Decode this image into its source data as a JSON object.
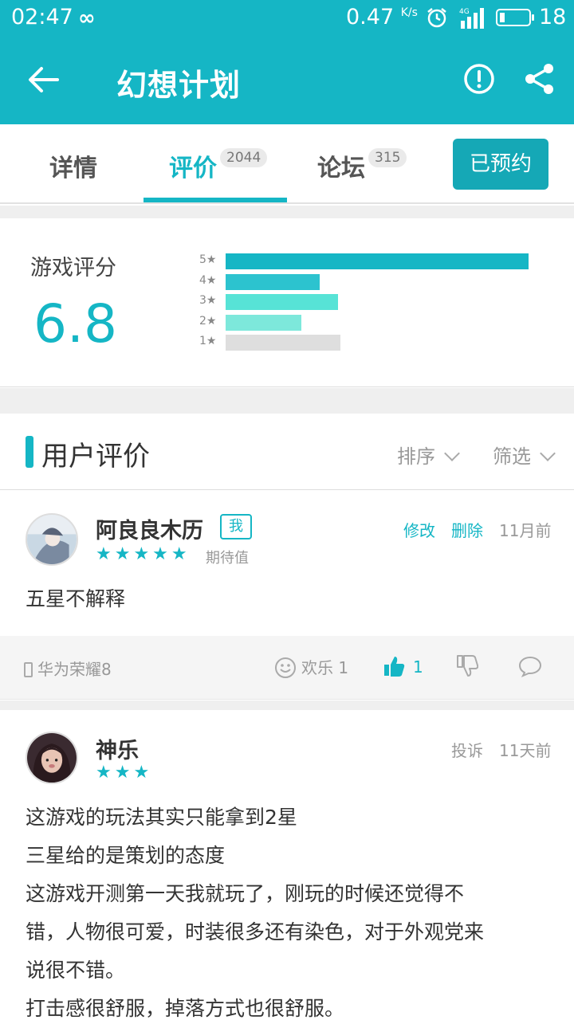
{
  "status_bar": {
    "time": "02:47",
    "infinity": "∞",
    "net_speed": "0.47",
    "net_unit": "K/s",
    "network": "4G",
    "battery": "18"
  },
  "app_bar": {
    "title": "幻想计划",
    "back_icon": "arrow-left-icon",
    "report_icon": "alert-circle-icon",
    "share_icon": "share-icon"
  },
  "tabs": [
    {
      "label": "详情",
      "count": ""
    },
    {
      "label": "评价",
      "count": "2044",
      "active": true
    },
    {
      "label": "论坛",
      "count": "315"
    }
  ],
  "reserve_button": "已预约",
  "rating": {
    "label": "游戏评分",
    "score": "6.8",
    "distribution": [
      {
        "star": "5",
        "value": 1.0,
        "color": "#15b6c5"
      },
      {
        "star": "4",
        "value": 0.31,
        "color": "#2cc3cf"
      },
      {
        "star": "3",
        "value": 0.37,
        "color": "#57e3d6"
      },
      {
        "star": "2",
        "value": 0.25,
        "color": "#7de8db"
      },
      {
        "star": "1",
        "value": 0.38,
        "color": "#dedede"
      }
    ]
  },
  "user_reviews": {
    "title": "用户评价",
    "sort_label": "排序",
    "filter_label": "筛选"
  },
  "reviews": [
    {
      "name": "阿良良木历",
      "badge": "我",
      "stars": "★★★★★",
      "rating_tag": "期待值",
      "edit": "修改",
      "delete": "删除",
      "time": "11月前",
      "content": [
        "五星不解释"
      ],
      "device": "华为荣耀8",
      "fun_label": "欢乐 1",
      "likes": "1"
    },
    {
      "name": "神乐",
      "stars": "★★★",
      "report": "投诉",
      "time": "11天前",
      "content": [
        "这游戏的玩法其实只能拿到2星",
        "三星给的是策划的态度",
        "这游戏开测第一天我就玩了，刚玩的时候还觉得不",
        "错，人物很可爱，时装很多还有染色，对于外观党来",
        "说很不错。",
        "打击感很舒服，掉落方式也很舒服。"
      ]
    }
  ],
  "colors": {
    "accent": "#15b6c5",
    "reserve": "#15a8b6"
  }
}
